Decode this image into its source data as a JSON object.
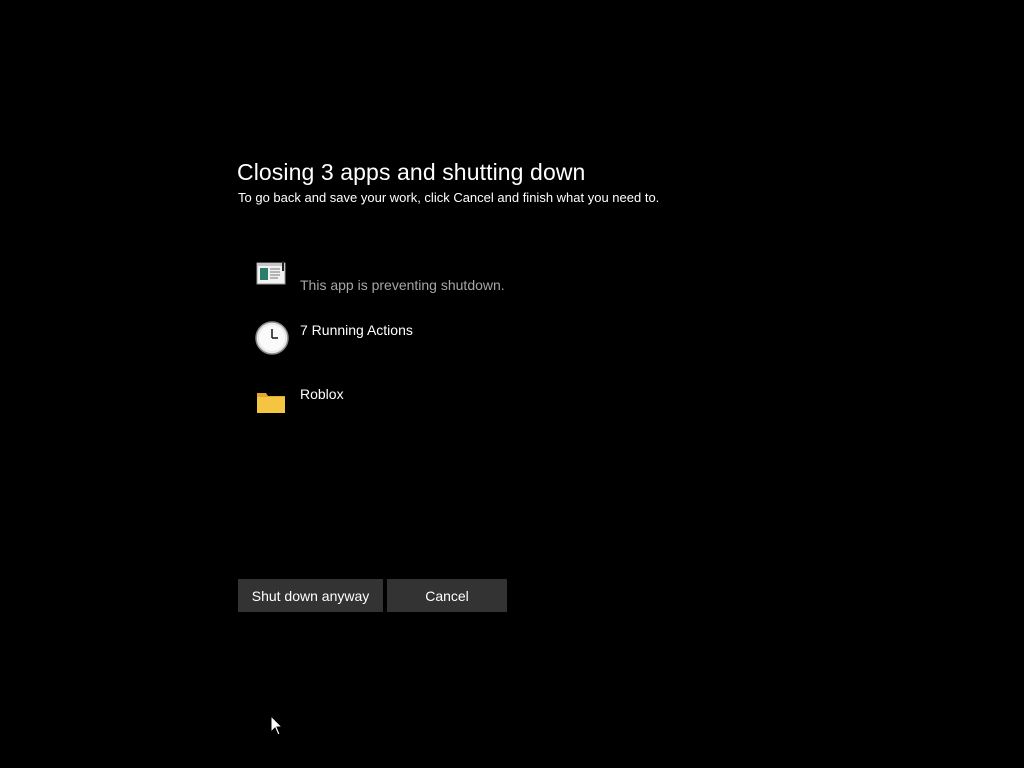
{
  "dialog": {
    "title": "Closing 3 apps and shutting down",
    "subtitle": "To go back and save your work, click Cancel and finish what you need to."
  },
  "apps": [
    {
      "name": "",
      "status": "This app is preventing shutdown.",
      "icon": "app-window-icon"
    },
    {
      "name": "7 Running Actions",
      "status": "",
      "icon": "clock-icon"
    },
    {
      "name": "Roblox",
      "status": "",
      "icon": "folder-icon"
    }
  ],
  "buttons": {
    "shutdown_label": "Shut down anyway",
    "cancel_label": "Cancel"
  },
  "colors": {
    "background": "#000000",
    "button_bg": "#333333",
    "status_text": "#a6a6a6",
    "folder": "#f5c542"
  }
}
